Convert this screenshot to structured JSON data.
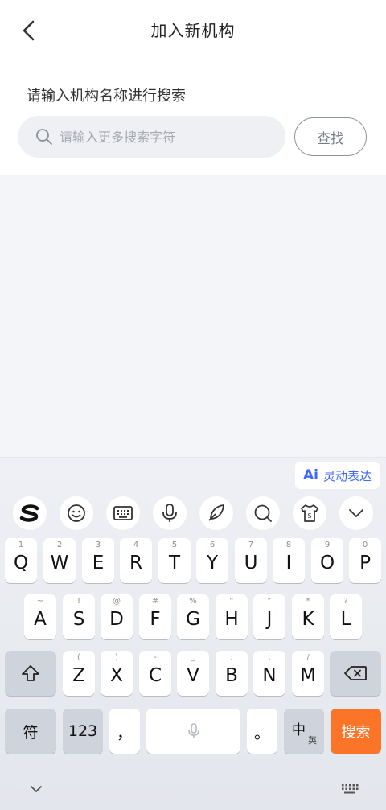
{
  "header": {
    "title": "加入新机构"
  },
  "prompt": "请输入机构名称进行搜索",
  "search": {
    "placeholder": "请输入更多搜索字符",
    "value": "",
    "button_label": "查找"
  },
  "keyboard": {
    "ai_chip": {
      "mark": "Ai",
      "label": "灵动表达"
    },
    "toolbar_icons": [
      "sogou-logo-icon",
      "emoji-icon",
      "keyboard-icon",
      "microphone-icon",
      "quill-pen-icon",
      "search-icon",
      "tshirt-skin-icon",
      "chevron-down-icon"
    ],
    "row1": [
      {
        "ch": "Q",
        "hint": "1"
      },
      {
        "ch": "W",
        "hint": "2"
      },
      {
        "ch": "E",
        "hint": "3"
      },
      {
        "ch": "R",
        "hint": "4"
      },
      {
        "ch": "T",
        "hint": "5"
      },
      {
        "ch": "Y",
        "hint": "6"
      },
      {
        "ch": "U",
        "hint": "7"
      },
      {
        "ch": "I",
        "hint": "8"
      },
      {
        "ch": "O",
        "hint": "9"
      },
      {
        "ch": "P",
        "hint": "0"
      }
    ],
    "row2": [
      {
        "ch": "A",
        "hint": "~"
      },
      {
        "ch": "S",
        "hint": "!"
      },
      {
        "ch": "D",
        "hint": "@"
      },
      {
        "ch": "F",
        "hint": "#"
      },
      {
        "ch": "G",
        "hint": "%"
      },
      {
        "ch": "H",
        "hint": "“"
      },
      {
        "ch": "J",
        "hint": "”"
      },
      {
        "ch": "K",
        "hint": "*"
      },
      {
        "ch": "L",
        "hint": "?"
      }
    ],
    "row3": [
      {
        "ch": "Z",
        "hint": "("
      },
      {
        "ch": "X",
        "hint": ")"
      },
      {
        "ch": "C",
        "hint": "-"
      },
      {
        "ch": "V",
        "hint": "_"
      },
      {
        "ch": "B",
        "hint": ":"
      },
      {
        "ch": "N",
        "hint": ";"
      },
      {
        "ch": "M",
        "hint": "/"
      }
    ],
    "row4": {
      "symbols": "符",
      "numbers": "123",
      "comma": "，",
      "period": "。",
      "lang_main": "中",
      "lang_sub": "英",
      "search": "搜索"
    }
  }
}
